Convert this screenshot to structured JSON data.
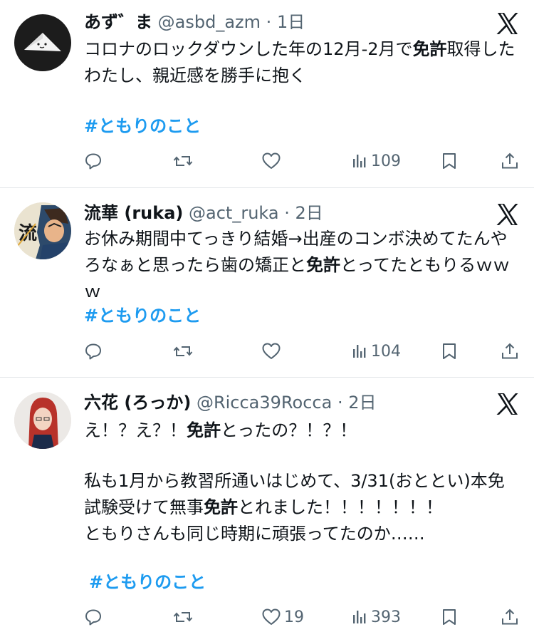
{
  "tweets": [
    {
      "name": "あず゛ま",
      "handle": "@asbd_azm",
      "sep": "·",
      "time": "1日",
      "text_before": "コロナのロックダウンした年の12月-2月で",
      "text_bold": "免許",
      "text_after": "取得したわたし、親近感を勝手に抱く",
      "hashtag": "#ともりのこと",
      "likes": "",
      "views": "109"
    },
    {
      "name": "流華 (ruka)",
      "handle": "@act_ruka",
      "sep": "·",
      "time": "2日",
      "text_before": "お休み期間中てっきり結婚→出産のコンボ決めてたんやろなぁと思ったら歯の矯正と",
      "text_bold": "免許",
      "text_after": "とってたともりるｗｗｗ",
      "hashtag": "#ともりのこと",
      "likes": "",
      "views": "104"
    },
    {
      "name": "六花 (ろっか)",
      "handle": "@Ricca39Rocca",
      "sep": "·",
      "time": "2日",
      "line1_before": "え！？え？！",
      "line1_bold": "免許",
      "line1_after": "とったの？！？！",
      "para2_before": "私も1月から教習所通いはじめて、3/31(おととい)本免試験受けて無事",
      "para2_bold": "免許",
      "para2_after": "とれました！！！！！！！",
      "line3": "ともりさんも同じ時期に頑張ってたのか……",
      "hashtag": "#ともりのこと",
      "likes": "19",
      "views": "393"
    }
  ],
  "icons": {
    "reply": "reply-icon",
    "retweet": "retweet-icon",
    "like": "heart-icon",
    "views": "views-icon",
    "bookmark": "bookmark-icon",
    "share": "share-icon",
    "platform": "x-logo-icon"
  },
  "colors": {
    "text": "#0f1419",
    "secondary": "#536471",
    "hashtag": "#1d9bf0",
    "divider": "#e3e6e9"
  }
}
